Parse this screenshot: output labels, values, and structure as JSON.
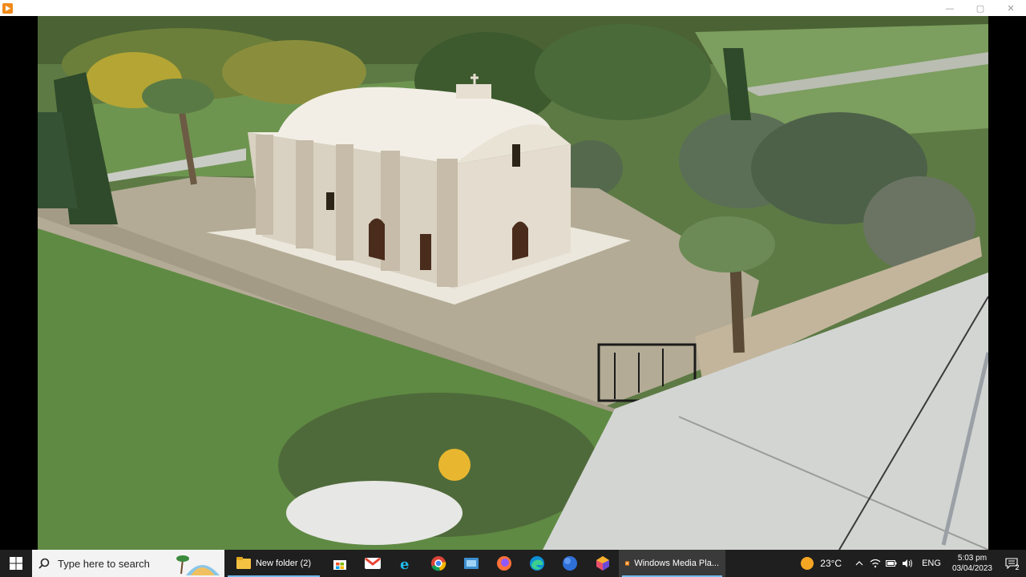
{
  "window": {
    "controls": [
      "—",
      "▢",
      "✕"
    ]
  },
  "taskbar": {
    "search": {
      "placeholder": "Type here to search"
    },
    "apps": [
      {
        "name": "file-explorer",
        "label": "New folder (2)"
      },
      {
        "name": "microsoft-store"
      },
      {
        "name": "gmail"
      },
      {
        "name": "internet-explorer"
      },
      {
        "name": "chrome"
      },
      {
        "name": "photos"
      },
      {
        "name": "firefox"
      },
      {
        "name": "edge"
      },
      {
        "name": "earth"
      },
      {
        "name": "paint-3d"
      },
      {
        "name": "windows-media-player",
        "label": "Windows Media Pla..."
      }
    ],
    "weather": {
      "temp": "23°C"
    },
    "language": "ENG",
    "clock": {
      "time": "5:03 pm",
      "date": "03/04/2023"
    },
    "notifications": {
      "count": "2"
    }
  },
  "colors": {
    "taskbar_bg": "#1f1f1f",
    "search_bg": "#f3f3f3",
    "running_indicator": "#76b9ed"
  }
}
